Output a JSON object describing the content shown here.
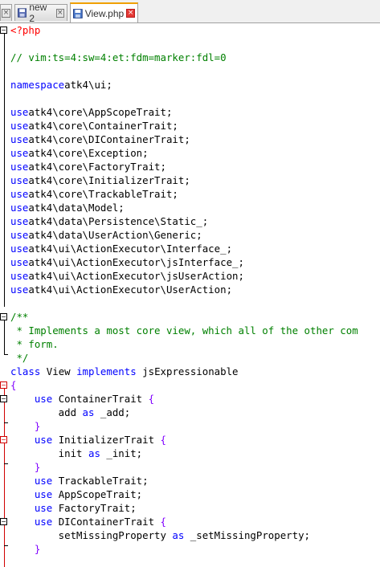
{
  "tabs": [
    {
      "label": "new 2",
      "active": false,
      "close_label": "×"
    },
    {
      "label": "View.php",
      "active": true,
      "close_label": "×"
    }
  ],
  "colors": {
    "keyword": "#0000ff",
    "comment": "#008000",
    "php_tag": "#ff0000",
    "brace": "#8000ff",
    "active_tab_accent": "#f0a000"
  },
  "fold_icons": {
    "collapse": "−"
  },
  "code_lines": [
    [
      [
        "php",
        "<?php"
      ]
    ],
    [],
    [
      [
        "com",
        "// vim:ts=4:sw=4:et:fdm=marker:fdl=0"
      ]
    ],
    [],
    [
      [
        "kw",
        "namespace"
      ],
      [
        "",
        "atk4\\ui;"
      ]
    ],
    [],
    [
      [
        "kw",
        "use"
      ],
      [
        "",
        "atk4\\core\\AppScopeTrait;"
      ]
    ],
    [
      [
        "kw",
        "use"
      ],
      [
        "",
        "atk4\\core\\ContainerTrait;"
      ]
    ],
    [
      [
        "kw",
        "use"
      ],
      [
        "",
        "atk4\\core\\DIContainerTrait;"
      ]
    ],
    [
      [
        "kw",
        "use"
      ],
      [
        "",
        "atk4\\core\\Exception;"
      ]
    ],
    [
      [
        "kw",
        "use"
      ],
      [
        "",
        "atk4\\core\\FactoryTrait;"
      ]
    ],
    [
      [
        "kw",
        "use"
      ],
      [
        "",
        "atk4\\core\\InitializerTrait;"
      ]
    ],
    [
      [
        "kw",
        "use"
      ],
      [
        "",
        "atk4\\core\\TrackableTrait;"
      ]
    ],
    [
      [
        "kw",
        "use"
      ],
      [
        "",
        "atk4\\data\\Model;"
      ]
    ],
    [
      [
        "kw",
        "use"
      ],
      [
        "",
        "atk4\\data\\Persistence\\Static_;"
      ]
    ],
    [
      [
        "kw",
        "use"
      ],
      [
        "",
        "atk4\\data\\UserAction\\Generic;"
      ]
    ],
    [
      [
        "kw",
        "use"
      ],
      [
        "",
        "atk4\\ui\\ActionExecutor\\Interface_;"
      ]
    ],
    [
      [
        "kw",
        "use"
      ],
      [
        "",
        "atk4\\ui\\ActionExecutor\\jsInterface_;"
      ]
    ],
    [
      [
        "kw",
        "use"
      ],
      [
        "",
        "atk4\\ui\\ActionExecutor\\jsUserAction;"
      ]
    ],
    [
      [
        "kw",
        "use"
      ],
      [
        "",
        "atk4\\ui\\ActionExecutor\\UserAction;"
      ]
    ],
    [],
    [
      [
        "com",
        "/**"
      ]
    ],
    [
      [
        "com",
        " * Implements a most core view, which all of the other com"
      ]
    ],
    [
      [
        "com",
        " * form."
      ]
    ],
    [
      [
        "com",
        " */"
      ]
    ],
    [
      [
        "kw",
        "class"
      ],
      [
        "",
        " View "
      ],
      [
        "kw",
        "implements"
      ],
      [
        "",
        " jsExpressionable"
      ]
    ],
    [
      [
        "br",
        "{"
      ]
    ],
    [
      [
        "",
        "    "
      ],
      [
        "kw",
        "use"
      ],
      [
        "",
        " ContainerTrait "
      ],
      [
        "br",
        "{"
      ]
    ],
    [
      [
        "",
        "        add "
      ],
      [
        "kw",
        "as"
      ],
      [
        "",
        " _add;"
      ]
    ],
    [
      [
        "",
        "    "
      ],
      [
        "br",
        "}"
      ]
    ],
    [
      [
        "",
        "    "
      ],
      [
        "kw",
        "use"
      ],
      [
        "",
        " InitializerTrait "
      ],
      [
        "br",
        "{"
      ]
    ],
    [
      [
        "",
        "        init "
      ],
      [
        "kw",
        "as"
      ],
      [
        "",
        " _init;"
      ]
    ],
    [
      [
        "",
        "    "
      ],
      [
        "br",
        "}"
      ]
    ],
    [
      [
        "",
        "    "
      ],
      [
        "kw",
        "use"
      ],
      [
        "",
        " TrackableTrait;"
      ]
    ],
    [
      [
        "",
        "    "
      ],
      [
        "kw",
        "use"
      ],
      [
        "",
        " AppScopeTrait;"
      ]
    ],
    [
      [
        "",
        "    "
      ],
      [
        "kw",
        "use"
      ],
      [
        "",
        " FactoryTrait;"
      ]
    ],
    [
      [
        "",
        "    "
      ],
      [
        "kw",
        "use"
      ],
      [
        "",
        " DIContainerTrait "
      ],
      [
        "br",
        "{"
      ]
    ],
    [
      [
        "",
        "        setMissingProperty "
      ],
      [
        "kw",
        "as"
      ],
      [
        "",
        " _setMissingProperty;"
      ]
    ],
    [
      [
        "",
        "    "
      ],
      [
        "br",
        "}"
      ]
    ]
  ]
}
